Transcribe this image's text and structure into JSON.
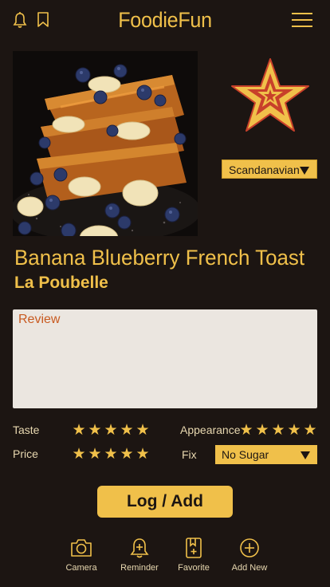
{
  "header": {
    "title": "FoodieFun",
    "icons": [
      "bell-icon",
      "bookmark-icon",
      "hamburger-menu-icon"
    ]
  },
  "dish": {
    "cuisine": "Scandanavian",
    "name": "Banana Blueberry French Toast",
    "restaurant": "La Poubelle"
  },
  "review": {
    "placeholder": "Review"
  },
  "ratings": {
    "taste_label": "Taste",
    "taste_stars": 5,
    "appearance_label": "Appearance",
    "appearance_stars": 5,
    "price_label": "Price",
    "price_stars": 5,
    "fix_label": "Fix",
    "fix_value": "No Sugar"
  },
  "actions": {
    "log_label": "Log / Add"
  },
  "nav": {
    "items": [
      {
        "label": "Camera",
        "icon": "camera-icon"
      },
      {
        "label": "Reminder",
        "icon": "reminder-bell-icon"
      },
      {
        "label": "Favorite",
        "icon": "favorite-icon"
      },
      {
        "label": "Add New",
        "icon": "add-new-icon"
      }
    ]
  },
  "colors": {
    "background": "#1c1512",
    "accent": "#f0c04a",
    "review_bg": "#ebe6e0",
    "review_placeholder": "#c85a20",
    "badge_red": "#c8402a"
  }
}
